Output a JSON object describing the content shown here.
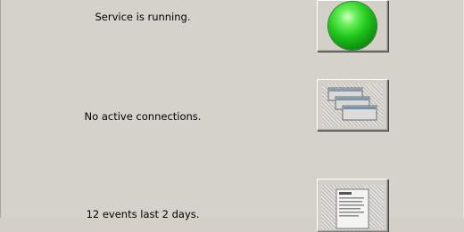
{
  "rows": [
    {
      "status_text": "Service is running.",
      "icon": "green-status-light-icon"
    },
    {
      "status_text": "No active connections.",
      "icon": "connections-windows-icon"
    },
    {
      "status_text": "12 events last 2 days.",
      "icon": "event-log-document-icon"
    }
  ],
  "colors": {
    "background": "#d4d0c8",
    "status_ok": "#20c81c"
  }
}
